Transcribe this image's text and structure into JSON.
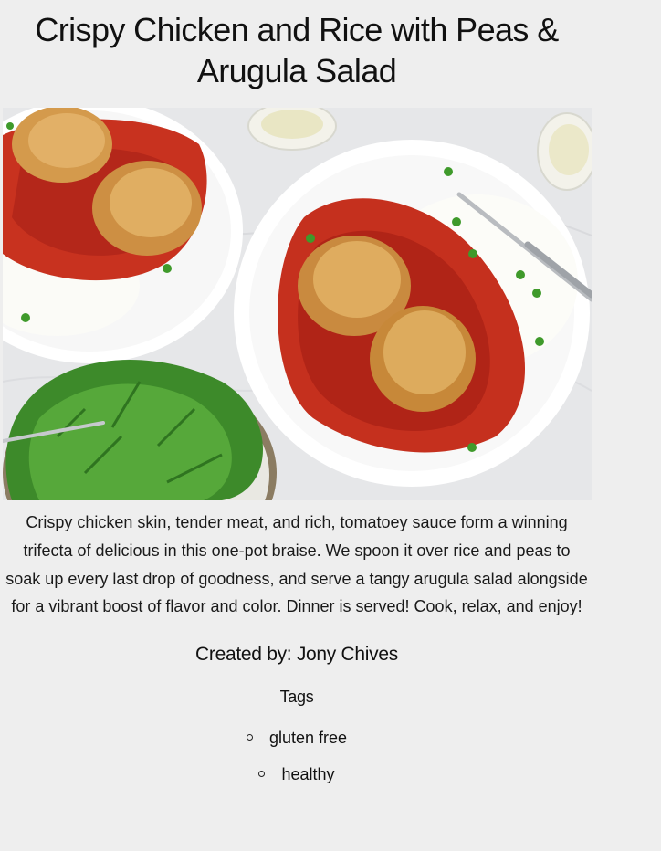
{
  "recipe": {
    "title": "Crispy Chicken and Rice with Peas & Arugula Salad",
    "image_alt": "Crispy chicken thighs over tomato sauce with rice and peas, with an arugula salad",
    "description": "Crispy chicken skin, tender meat, and rich, tomatoey sauce form a winning trifecta of delicious in this one-pot braise. We spoon it over rice and peas to soak up every last drop of goodness, and serve a tangy arugula salad alongside for a vibrant boost of flavor and color. Dinner is served! Cook, relax, and enjoy!",
    "created_by": "Created by: Jony Chives",
    "tags_heading": "Tags",
    "tags": [
      "gluten free",
      "healthy"
    ]
  }
}
